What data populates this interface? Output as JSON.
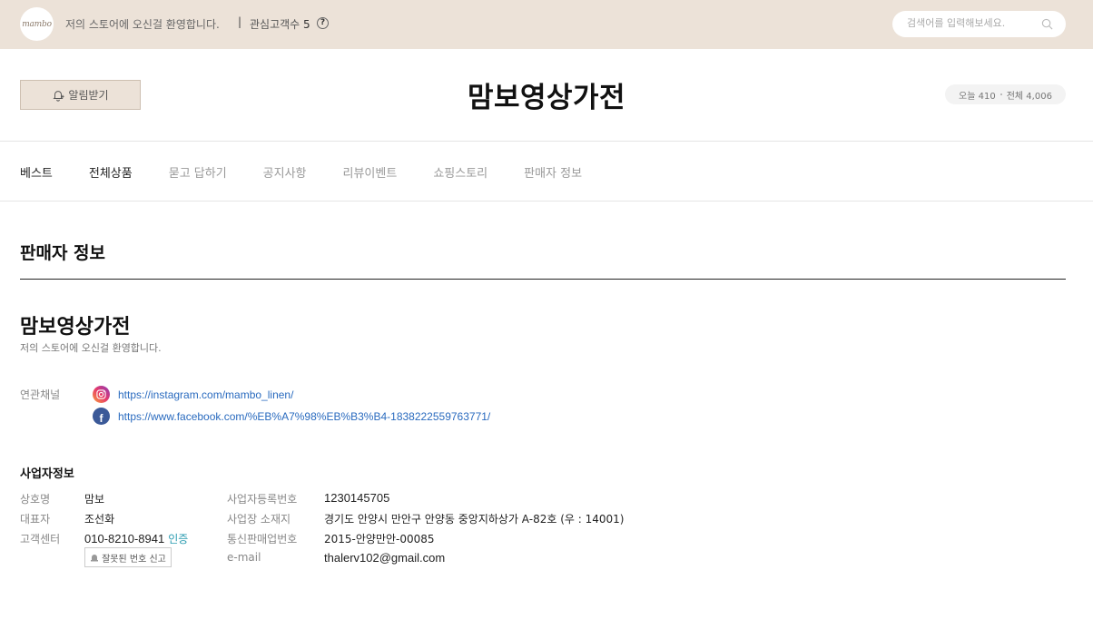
{
  "topbar": {
    "logo_text": "mambo",
    "welcome": "저의 스토어에 오신걸 환영합니다.",
    "separator": "|",
    "interest_label": "관심고객수",
    "interest_count": "5",
    "help": "?",
    "search_placeholder": "검색어를 입력해보세요."
  },
  "header": {
    "alarm_label": "알림받기",
    "store_title": "맘보영상가전",
    "visits_today": "오늘 410",
    "visits_total": "전체 4,006"
  },
  "nav": {
    "items": [
      {
        "label": "베스트",
        "active": true
      },
      {
        "label": "전체상품",
        "active": true
      },
      {
        "label": "묻고 답하기",
        "active": false
      },
      {
        "label": "공지사항",
        "active": false
      },
      {
        "label": "리뷰이벤트",
        "active": false
      },
      {
        "label": "쇼핑스토리",
        "active": false
      },
      {
        "label": "판매자 정보",
        "active": false
      }
    ]
  },
  "section": {
    "title": "판매자 정보",
    "seller_name": "맘보영상가전",
    "seller_desc": "저의 스토어에 오신걸 환영합니다.",
    "channel_label": "연관채널",
    "channels": [
      {
        "icon": "instagram-icon",
        "url": "https://instagram.com/mambo_linen/"
      },
      {
        "icon": "facebook-icon",
        "url": "https://www.facebook.com/%EB%A7%98%EB%B3%B4-1838222559763771/"
      }
    ]
  },
  "business": {
    "title": "사업자정보",
    "left": [
      {
        "label": "상호명",
        "value": "맘보"
      },
      {
        "label": "대표자",
        "value": "조선화"
      },
      {
        "label": "고객센터",
        "value": "010-8210-8941"
      }
    ],
    "verify_label": "인증",
    "report_label": "잘못된 번호 신고",
    "right": [
      {
        "label": "사업자등록번호",
        "value": "1230145705"
      },
      {
        "label": "사업장 소재지",
        "value": "경기도 안양시 만안구 안양동 중앙지하상가 A-82호 (우 : 14001)"
      },
      {
        "label": "통신판매업번호",
        "value": "2015-안양만안-00085"
      },
      {
        "label": "e-mail",
        "value": "thalerv102@gmail.com"
      }
    ]
  },
  "colors": {
    "topbar_bg": "#ece2d8",
    "link": "#2a6bbf",
    "verify": "#2a9bb0"
  }
}
